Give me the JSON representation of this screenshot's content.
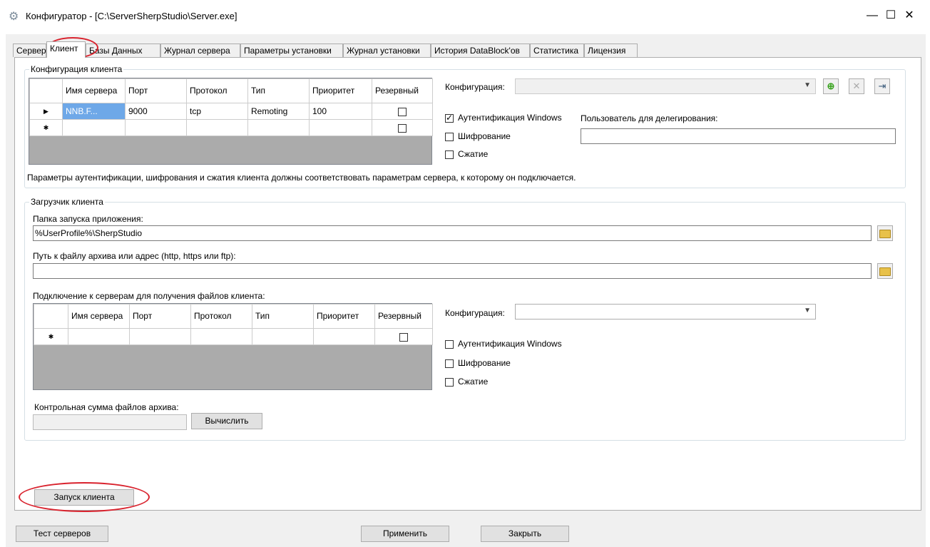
{
  "window": {
    "title": "Конфигуратор - [C:\\ServerSherpStudio\\Server.exe]",
    "minimize_glyph": "—",
    "maximize_glyph": "☐",
    "close_glyph": "✕",
    "icon": "gear-icon"
  },
  "tabs": [
    {
      "label": "Сервер"
    },
    {
      "label": "Клиент",
      "active": true
    },
    {
      "label": "Базы Данных"
    },
    {
      "label": "Журнал сервера"
    },
    {
      "label": "Параметры установки"
    },
    {
      "label": "Журнал установки"
    },
    {
      "label": "История DataBlock'ов"
    },
    {
      "label": "Статистика"
    },
    {
      "label": "Лицензия"
    }
  ],
  "client_config": {
    "legend": "Конфигурация клиента",
    "columns": [
      "Имя сервера",
      "Порт",
      "Протокол",
      "Тип",
      "Приоритет",
      "Резервный"
    ],
    "rows": [
      {
        "marker": "▶",
        "server": "NNB.F...",
        "port": "9000",
        "protocol": "tcp",
        "type": "Remoting",
        "priority": "100",
        "reserve": false
      }
    ],
    "new_row_marker": "✱",
    "configuration_label": "Конфигурация:",
    "configuration_value": "",
    "auth_windows_label": "Аутентификация Windows",
    "auth_windows_checked": true,
    "encryption_label": "Шифрование",
    "encryption_checked": false,
    "compression_label": "Сжатие",
    "compression_checked": false,
    "delegation_user_label": "Пользователь для делегирования:",
    "delegation_user_value": "",
    "note": "Параметры аутентификации, шифрования и сжатия клиента должны соответствовать параметрам сервера, к которому он подключается."
  },
  "loader": {
    "legend": "Загрузчик клиента",
    "launch_folder_label": "Папка запуска приложения:",
    "launch_folder_value": "%UserProfile%\\SherpStudio",
    "archive_path_label": "Путь к файлу архива или адрес (http, https или ftp):",
    "archive_path_value": "",
    "servers_label": "Подключение к серверам для получения файлов клиента:",
    "columns": [
      "Имя сервера",
      "Порт",
      "Протокол",
      "Тип",
      "Приоритет",
      "Резервный"
    ],
    "new_row_marker": "✱",
    "configuration_label": "Конфигурация:",
    "configuration_value": "",
    "auth_windows_label": "Аутентификация Windows",
    "auth_windows_checked": false,
    "encryption_label": "Шифрование",
    "encryption_checked": false,
    "compression_label": "Сжатие",
    "compression_checked": false,
    "checksum_label": "Контрольная сумма файлов архива:",
    "checksum_value": "",
    "compute_button": "Вычислить"
  },
  "launch_client_button": "Запуск клиента",
  "footer": {
    "test_servers": "Тест серверов",
    "apply": "Применить",
    "close": "Закрыть"
  },
  "colors": {
    "annotation_ring": "#d9232e",
    "add_icon": "#3aa320"
  }
}
